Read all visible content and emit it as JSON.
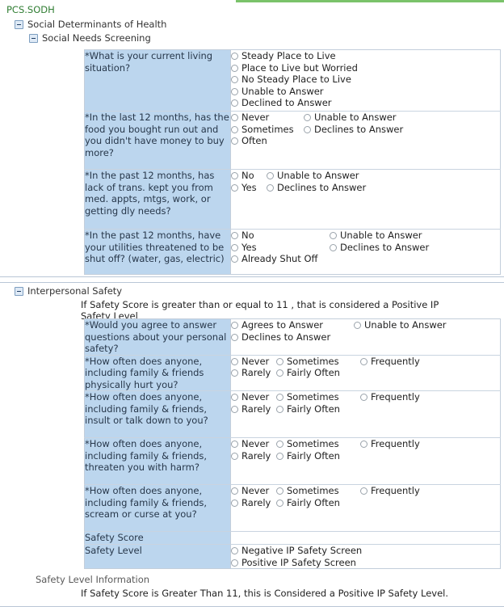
{
  "context_label": "PCS.SODH",
  "tree": {
    "root_label": "Social Determinants of Health",
    "child_label": "Social Needs Screening"
  },
  "social_needs": {
    "rows": [
      {
        "question": "*What is your current living situation?",
        "columns": [
          [
            "Steady Place to Live",
            "Place to Live but Worried",
            "No Steady Place to Live",
            "Unable to Answer",
            "Declined to Answer"
          ]
        ]
      },
      {
        "question": "*In the last 12 months, has the food you bought run out and you didn't have money to buy more?",
        "columns": [
          [
            "Never",
            "Sometimes",
            "Often"
          ],
          [
            "Unable to Answer",
            "Declines to Answer"
          ]
        ]
      },
      {
        "question": "*In the past 12 months, has lack of trans. kept you from med. appts, mtgs, work, or getting dly needs?",
        "columns": [
          [
            "No",
            "Yes"
          ],
          [
            "Unable to Answer",
            "Declines to Answer"
          ]
        ]
      },
      {
        "question": "*In the past 12 months, have your utilities threatened to be shut off? (water, gas, electric)",
        "columns": [
          [
            "No",
            "Yes",
            "Already Shut Off"
          ],
          [
            "Unable to Answer",
            "Declines to Answer"
          ]
        ]
      }
    ]
  },
  "interpersonal_safety": {
    "section_label": "Interpersonal Safety",
    "section_note": "If Safety Score is greater than or equal to 11 , that is considered a Positive IP Safety Level",
    "rows": [
      {
        "question": "*Would you agree to answer questions about your personal safety?",
        "columns": [
          [
            "Agrees to Answer",
            "Declines to Answer"
          ],
          [
            "Unable to Answer"
          ]
        ]
      },
      {
        "question": "*How often does anyone, including family & friends physically hurt you?",
        "columns": [
          [
            "Never",
            "Rarely"
          ],
          [
            "Sometimes",
            "Fairly Often"
          ],
          [
            "Frequently"
          ]
        ]
      },
      {
        "question": "*How often does anyone, including family & friends, insult or talk down to you?",
        "columns": [
          [
            "Never",
            "Rarely"
          ],
          [
            "Sometimes",
            "Fairly Often"
          ],
          [
            "Frequently"
          ]
        ]
      },
      {
        "question": "*How often does anyone, including family & friends, threaten you with harm?",
        "columns": [
          [
            "Never",
            "Rarely"
          ],
          [
            "Sometimes",
            "Fairly Often"
          ],
          [
            "Frequently"
          ]
        ]
      },
      {
        "question": "*How often does anyone, including family & friends, scream or curse at you?",
        "columns": [
          [
            "Never",
            "Rarely"
          ],
          [
            "Sometimes",
            "Fairly Often"
          ],
          [
            "Frequently"
          ]
        ]
      },
      {
        "question": "Safety Score",
        "columns": []
      },
      {
        "question": "Safety Level",
        "columns": [
          [
            "Negative IP Safety Screen",
            "Positive IP Safety Screen"
          ]
        ]
      }
    ],
    "footer_title": "Safety Level Information",
    "footer_note": "If Safety Score is Greater Than 11, this is Considered a Positive IP Safety Level."
  },
  "colors": {
    "question_cell": "#bcd6ee",
    "accent_green": "#7ac36a",
    "context_text": "#2f7d32",
    "panel_border": "#b9c6d6"
  }
}
